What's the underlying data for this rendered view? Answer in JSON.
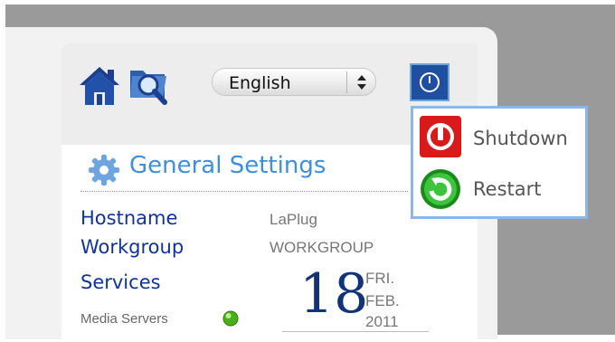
{
  "toolbar": {
    "language": "English"
  },
  "power_menu": {
    "items": [
      {
        "label": "Shutdown",
        "icon": "shutdown-icon",
        "color": "#d91a1a"
      },
      {
        "label": "Restart",
        "icon": "restart-icon",
        "color": "#1a9a1a"
      }
    ]
  },
  "general_settings": {
    "title": "General Settings",
    "hostname_label": "Hostname",
    "hostname_value": "LaPlug",
    "workgroup_label": "Workgroup",
    "workgroup_value": "WORKGROUP",
    "services_label": "Services",
    "media_servers_label": "Media Servers",
    "media_servers_status_color": "#4caf1a"
  },
  "date": {
    "day": "18",
    "weekday": "FRI.",
    "month": "FEB.",
    "year": "2011"
  },
  "colors": {
    "accent": "#3d8fe0",
    "label_blue": "#10339a",
    "power_button": "#1f4fa0"
  }
}
